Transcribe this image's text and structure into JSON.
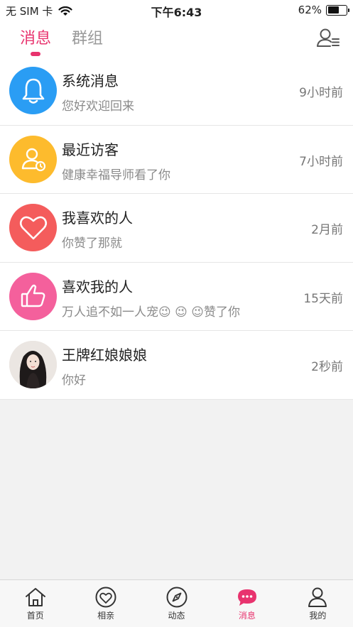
{
  "status_bar": {
    "carrier": "无 SIM 卡",
    "time": "下午6:43",
    "battery": "62%",
    "battery_level": 0.62
  },
  "header": {
    "tabs": [
      {
        "label": "消息",
        "active": true
      },
      {
        "label": "群组",
        "active": false
      }
    ],
    "right_icon": "contacts-icon"
  },
  "messages": [
    {
      "title": "系统消息",
      "subtitle": "您好欢迎回来",
      "time": "9小时前",
      "icon": "bell-icon",
      "color": "#2a9df4"
    },
    {
      "title": "最近访客",
      "subtitle": "健康幸福导师看了你",
      "time": "7小时前",
      "icon": "visitor-icon",
      "color": "#fdbb2d"
    },
    {
      "title": "我喜欢的人",
      "subtitle": "你赞了那就",
      "time": "2月前",
      "icon": "heart-icon",
      "color": "#f45c5c"
    },
    {
      "title": "喜欢我的人",
      "subtitle": "万人追不如一人宠😉 😉 😉赞了你",
      "time": "15天前",
      "icon": "thumbs-up-icon",
      "color": "#f4609c"
    },
    {
      "title": "王牌红娘娘娘",
      "subtitle": "你好",
      "time": "2秒前",
      "icon": "avatar-photo",
      "color": "#e9e4e0"
    }
  ],
  "tabbar": [
    {
      "label": "首页",
      "icon": "home-icon",
      "active": false
    },
    {
      "label": "相亲",
      "icon": "heart-circle-icon",
      "active": false
    },
    {
      "label": "动态",
      "icon": "compass-icon",
      "active": false
    },
    {
      "label": "消息",
      "icon": "chat-bubble-icon",
      "active": true
    },
    {
      "label": "我的",
      "icon": "person-icon",
      "active": false
    }
  ]
}
